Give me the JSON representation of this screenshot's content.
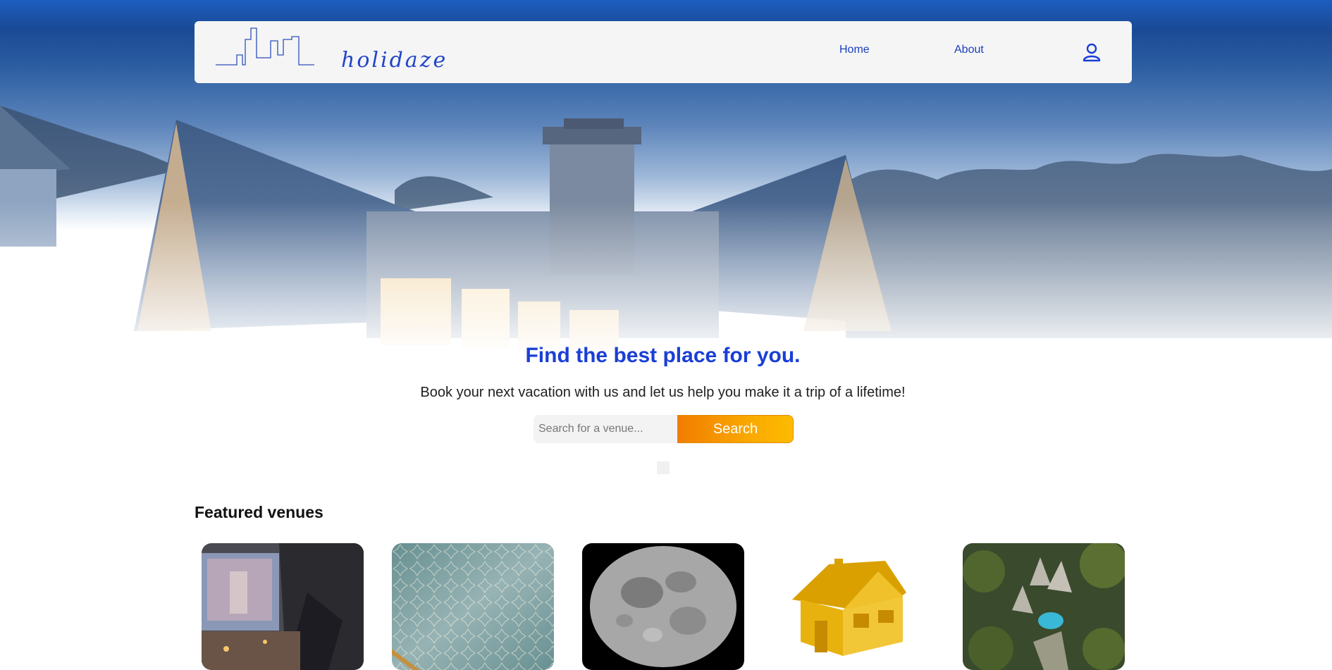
{
  "nav": {
    "logo_text": "holidaze",
    "home_label": "Home",
    "about_label": "About",
    "profile_icon": "user-icon"
  },
  "hero": {
    "headline": "Find the best place for you.",
    "subline": "Book your next vacation with us and let us help you make it a trip of a lifetime!"
  },
  "search": {
    "placeholder": "Search for a venue...",
    "button_label": "Search"
  },
  "featured": {
    "title": "Featured venues",
    "venues": [
      {
        "image": "outdoor-cinema-night"
      },
      {
        "image": "patterned-wall-stairs"
      },
      {
        "image": "full-moon"
      },
      {
        "image": "golden-house-model"
      },
      {
        "image": "jungle-villa-aerial"
      }
    ]
  },
  "colors": {
    "brand_blue": "#1a3fd6",
    "search_orange": "#f17d00",
    "search_yellow": "#fdbb00"
  }
}
